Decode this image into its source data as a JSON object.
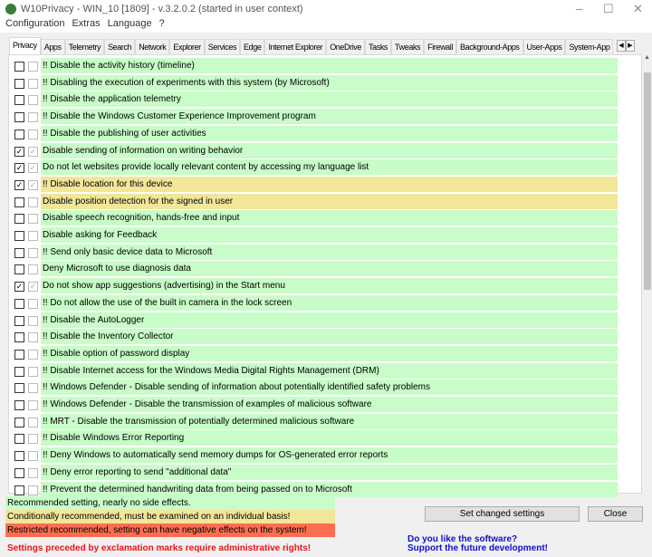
{
  "window": {
    "title": "W10Privacy - WIN_10 [1809]  - v.3.2.0.2 (started in user context)"
  },
  "menu": [
    "Configuration",
    "Extras",
    "Language",
    "?"
  ],
  "tabs": [
    "Privacy",
    "Apps",
    "Telemetry",
    "Search",
    "Network",
    "Explorer",
    "Services",
    "Edge",
    "Internet Explorer",
    "OneDrive",
    "Tasks",
    "Tweaks",
    "Firewall",
    "Background-Apps",
    "User-Apps",
    "System-App"
  ],
  "colors": {
    "green": "#c8fcc8",
    "yellow": "#f2e699",
    "red": "#fd6e51"
  },
  "settings": [
    {
      "label": "!! Disable the activity history (timeline)",
      "checked": false,
      "color": "green"
    },
    {
      "label": "!! Disabling the execution of experiments with this system (by Microsoft)",
      "checked": false,
      "color": "green"
    },
    {
      "label": "!! Disable the application telemetry",
      "checked": false,
      "color": "green"
    },
    {
      "label": "!! Disable the Windows Customer Experience Improvement program",
      "checked": false,
      "color": "green"
    },
    {
      "label": "!! Disable the publishing of user activities",
      "checked": false,
      "color": "green"
    },
    {
      "label": "Disable sending of information on writing behavior",
      "checked": true,
      "color": "green"
    },
    {
      "label": "Do not let websites provide locally relevant content by accessing my language list",
      "checked": true,
      "color": "green"
    },
    {
      "label": "!! Disable location for this device",
      "checked": true,
      "color": "yellow"
    },
    {
      "label": "Disable position detection for the signed in user",
      "checked": false,
      "color": "yellow"
    },
    {
      "label": "Disable speech recognition, hands-free and input",
      "checked": false,
      "color": "green"
    },
    {
      "label": "Disable asking for Feedback",
      "checked": false,
      "color": "green"
    },
    {
      "label": "!! Send only basic device data to Microsoft",
      "checked": false,
      "color": "green"
    },
    {
      "label": "Deny Microsoft to use diagnosis data",
      "checked": false,
      "color": "green"
    },
    {
      "label": "Do not show app suggestions (advertising) in the Start menu",
      "checked": true,
      "color": "green"
    },
    {
      "label": "!! Do not allow the use of the built in camera in the lock screen",
      "checked": false,
      "color": "green"
    },
    {
      "label": "!! Disable the AutoLogger",
      "checked": false,
      "color": "green"
    },
    {
      "label": "!! Disable the Inventory Collector",
      "checked": false,
      "color": "green"
    },
    {
      "label": "!! Disable option of password display",
      "checked": false,
      "color": "green"
    },
    {
      "label": "!! Disable Internet access for the Windows Media Digital Rights Management (DRM)",
      "checked": false,
      "color": "green"
    },
    {
      "label": "!! Windows Defender - Disable sending of information about potentially identified safety problems",
      "checked": false,
      "color": "green"
    },
    {
      "label": "!! Windows Defender - Disable the transmission of examples of malicious software",
      "checked": false,
      "color": "green"
    },
    {
      "label": "!! MRT - Disable the transmission of potentially determined malicious software",
      "checked": false,
      "color": "green"
    },
    {
      "label": "!! Disable Windows Error Reporting",
      "checked": false,
      "color": "green"
    },
    {
      "label": "!! Deny Windows to automatically send memory dumps for OS-generated error reports",
      "checked": false,
      "color": "green"
    },
    {
      "label": "!! Deny error reporting to send \"additional data\"",
      "checked": false,
      "color": "green"
    },
    {
      "label": "!! Prevent the determined handwriting data from being passed on to Microsoft",
      "checked": false,
      "color": "green"
    }
  ],
  "legend": {
    "green": "Recommended setting, nearly no side effects.",
    "yellow": "Conditionally recommended, must be examined on an individual basis!",
    "red": "Restricted recommended, setting can have negative effects on the system!"
  },
  "buttons": {
    "set": "Set changed settings",
    "close": "Close"
  },
  "warning": "Settings preceded by exclamation marks require administrative rights!",
  "support": {
    "line1": "Do you like the software?",
    "line2": "Support the future development!"
  }
}
